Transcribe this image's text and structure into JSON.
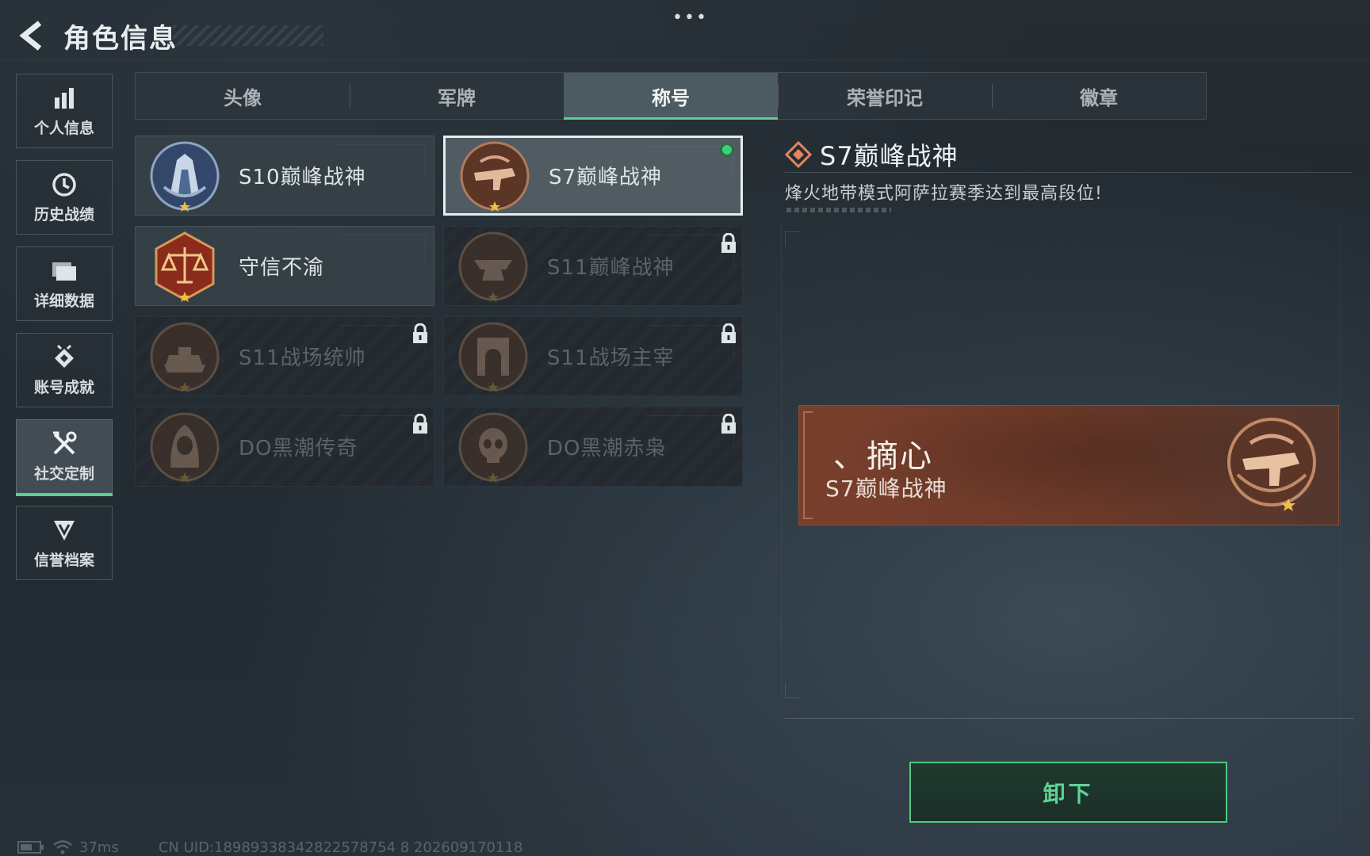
{
  "header": {
    "title": "角色信息"
  },
  "top_menu": "•••",
  "sidebar": {
    "items": [
      {
        "label": "个人信息",
        "icon": "bar-chart-icon"
      },
      {
        "label": "历史战绩",
        "icon": "clock-icon"
      },
      {
        "label": "详细数据",
        "icon": "folder-icon"
      },
      {
        "label": "账号成就",
        "icon": "achievement-icon"
      },
      {
        "label": "社交定制",
        "icon": "tools-icon",
        "active": true
      },
      {
        "label": "信誉档案",
        "icon": "credit-shield-icon"
      }
    ]
  },
  "tabs": [
    {
      "label": "头像"
    },
    {
      "label": "军牌"
    },
    {
      "label": "称号",
      "active": true
    },
    {
      "label": "荣誉印记"
    },
    {
      "label": "徽章"
    }
  ],
  "cards": [
    {
      "name": "S10巅峰战神",
      "locked": false,
      "selected": false,
      "badge": "blue-tower-badge"
    },
    {
      "name": "S7巅峰战神",
      "locked": false,
      "selected": true,
      "equipped": true,
      "badge": "bronze-gun-badge"
    },
    {
      "name": "守信不渝",
      "locked": false,
      "selected": false,
      "badge": "red-scales-badge"
    },
    {
      "name": "S11巅峰战神",
      "locked": true,
      "badge": "bronze-anvil-badge"
    },
    {
      "name": "S11战场统帅",
      "locked": true,
      "badge": "bronze-tank-badge"
    },
    {
      "name": "S11战场主宰",
      "locked": true,
      "badge": "bronze-arch-badge"
    },
    {
      "name": "DO黑潮传奇",
      "locked": true,
      "badge": "bronze-hooded-badge"
    },
    {
      "name": "DO黑潮赤枭",
      "locked": true,
      "badge": "bronze-skull-badge"
    }
  ],
  "detail": {
    "title": "S7巅峰战神",
    "description": "烽火地带模式阿萨拉赛季达到最高段位!",
    "nameplate": {
      "player_name": "、摘心",
      "title": "S7巅峰战神"
    }
  },
  "unequip_button": "卸下",
  "status_bar": {
    "ping": "37ms",
    "uid": "CN UID:18989338342822578754 8 202609170118"
  },
  "colors": {
    "accent_green": "#5fcf8f",
    "nameplate_bronze": "#7a3f2c",
    "equipped_dot": "#3ad176"
  }
}
